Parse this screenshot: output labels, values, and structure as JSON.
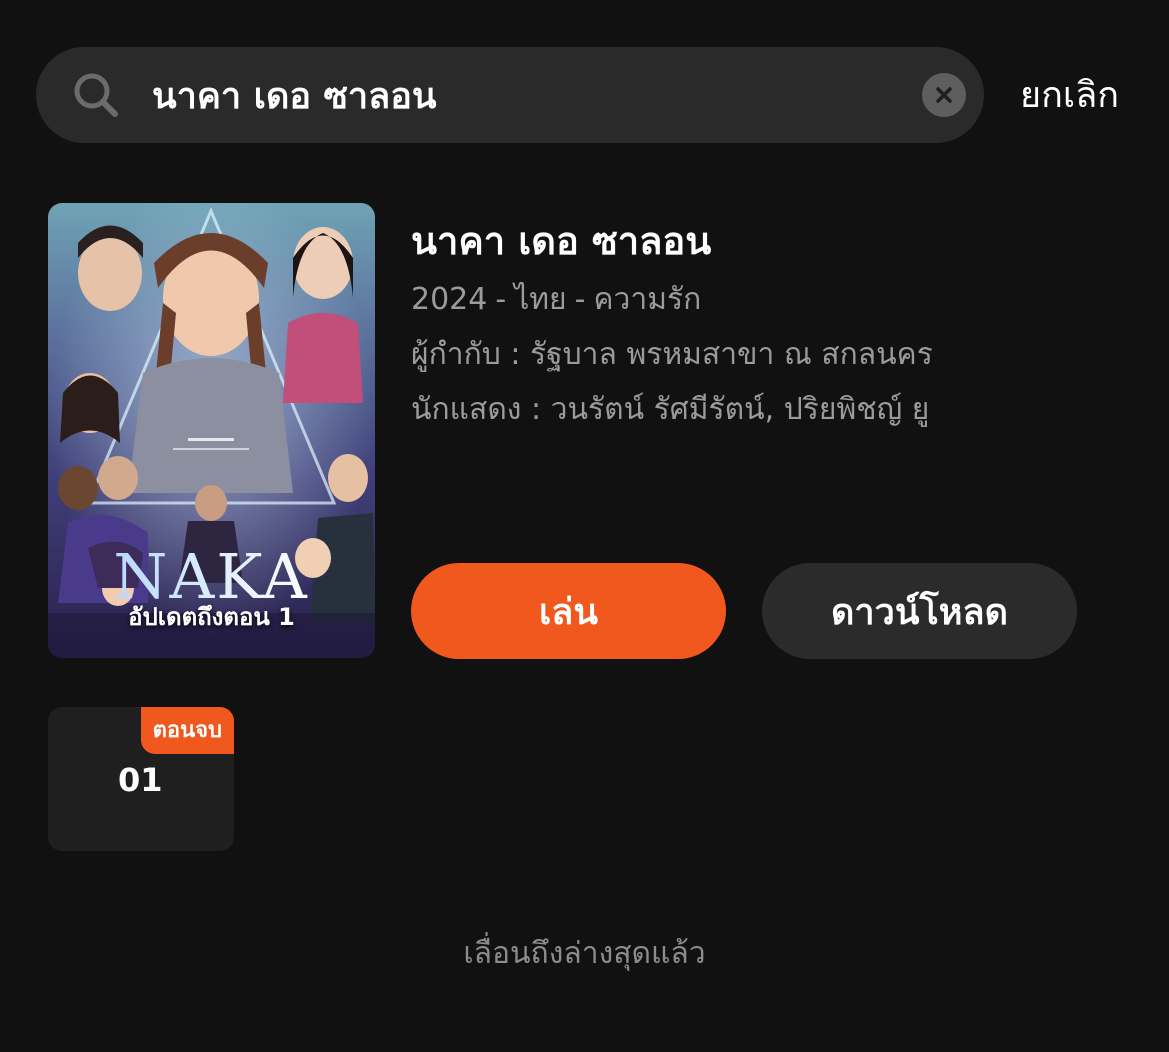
{
  "search": {
    "query": "นาคา เดอ ซาลอน",
    "cancel_label": "ยกเลิก",
    "icon": "search-icon",
    "clear_icon": "close-icon"
  },
  "result": {
    "title": "นาคา เดอ ซาลอน",
    "year": "2024",
    "country": "ไทย",
    "genre": "ความรัก",
    "separator": "-",
    "director": "ผู้กำกับ : รัฐบาล พรหมสาขา ณ สกลนคร",
    "cast": "นักแสดง : วนรัตน์ รัศมีรัตน์, ปริยพิชญ์ ยู",
    "poster_badge": "อัปเดตถึงตอน 1",
    "play_label": "เล่น",
    "download_label": "ดาวน์โหลด"
  },
  "episodes": [
    {
      "number": "01",
      "badge": "ตอนจบ"
    }
  ],
  "footer": {
    "end_text": "เลื่อนถึงล่างสุดแล้ว"
  },
  "colors": {
    "background": "#111111",
    "accent": "#f0581e",
    "search_bg": "#2a2a2a",
    "muted_text": "#9b9b9b"
  }
}
